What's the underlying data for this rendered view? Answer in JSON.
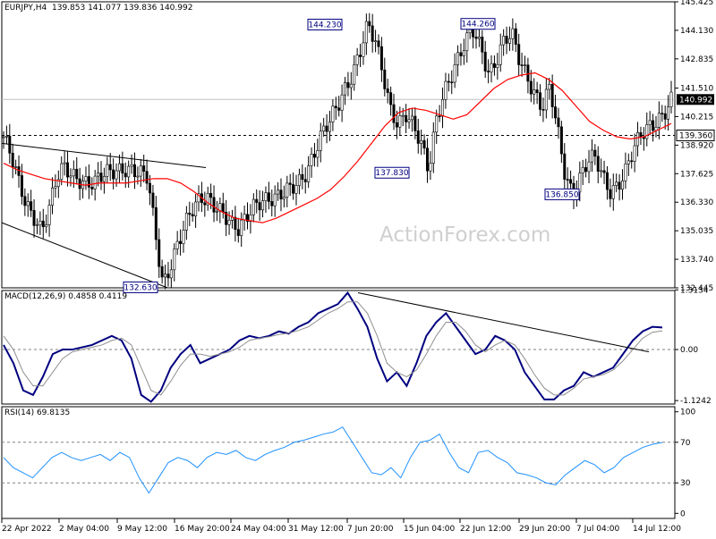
{
  "chart_data": [
    {
      "type": "candlestick",
      "title": "EURJPY,H4",
      "ohlc_text": "139.853 141.077 139.836 140.992",
      "last_price": 140.992,
      "last_price_label": "140.992",
      "ylim": [
        132.445,
        145.425
      ],
      "y_ticks": [
        "145.425",
        "144.130",
        "142.835",
        "141.510",
        "140.215",
        "138.920",
        "137.625",
        "136.330",
        "135.035",
        "133.740",
        "132.445"
      ],
      "x_labels": [
        "22 Apr 2022",
        "2 May 04:00",
        "9 May 12:00",
        "16 May 20:00",
        "24 May 04:00",
        "31 May 12:00",
        "7 Jun 20:00",
        "15 Jun 04:00",
        "22 Jun 12:00",
        "29 Jun 20:00",
        "7 Jul 04:00",
        "14 Jul 12:00"
      ],
      "level_line": 139.36,
      "level_label": "139.360",
      "annotations": [
        {
          "text": "144.230",
          "value": 144.23
        },
        {
          "text": "144.260",
          "value": 144.26
        },
        {
          "text": "137.830",
          "value": 137.83
        },
        {
          "text": "136.850",
          "value": 136.85
        },
        {
          "text": "132.630",
          "value": 132.63
        }
      ],
      "price_path": [
        139.3,
        138.3,
        137.1,
        136.2,
        135.8,
        135.2,
        136.0,
        137.3,
        137.8,
        137.6,
        137.5,
        137.3,
        137.2,
        137.4,
        137.6,
        137.8,
        138.0,
        137.9,
        137.6,
        137.3,
        134.8,
        132.63,
        133.6,
        134.6,
        135.3,
        135.9,
        136.4,
        136.6,
        136.3,
        135.9,
        135.2,
        134.9,
        135.6,
        136.3,
        136.6,
        136.5,
        136.4,
        136.6,
        137.0,
        137.4,
        137.9,
        138.6,
        139.3,
        139.9,
        140.7,
        141.6,
        142.3,
        143.2,
        144.23,
        143.5,
        142.2,
        140.7,
        140.0,
        140.3,
        139.6,
        138.9,
        137.83,
        140.2,
        141.4,
        142.0,
        142.7,
        143.6,
        144.26,
        143.4,
        142.2,
        142.7,
        143.5,
        143.9,
        142.9,
        142.2,
        141.3,
        140.5,
        141.4,
        139.6,
        137.7,
        136.85,
        137.5,
        138.1,
        138.2,
        137.4,
        136.9,
        137.3,
        137.8,
        138.6,
        139.2,
        139.7,
        140.1,
        140.5,
        140.992
      ],
      "moving_average": {
        "path": [
          138.1,
          137.8,
          137.6,
          137.4,
          137.3,
          137.2,
          137.1,
          137.2,
          137.2,
          137.2,
          137.3,
          137.4,
          137.4,
          137.2,
          136.8,
          136.3,
          135.9,
          135.6,
          135.5,
          135.4,
          135.6,
          135.9,
          136.2,
          136.5,
          136.9,
          137.5,
          138.2,
          139.0,
          139.8,
          140.4,
          140.6,
          140.5,
          140.3,
          140.1,
          140.3,
          140.9,
          141.5,
          141.9,
          142.1,
          142.2,
          141.9,
          141.4,
          140.7,
          140.0,
          139.6,
          139.3,
          139.2,
          139.3,
          139.6,
          139.9
        ],
        "color": "#ff0000"
      },
      "channel_lines": [
        {
          "start": 139.0,
          "end": 137.9
        },
        {
          "start": 135.4,
          "end": 132.45
        }
      ],
      "watermark": "ActionForex.com"
    },
    {
      "type": "line",
      "title": "MACD(12,26,9) 0.4858 0.4119",
      "ylim": [
        -1.2,
        1.3
      ],
      "y_ticks": [
        "1.3134",
        "0.00",
        "-1.1242"
      ],
      "series": [
        {
          "color": "#000080",
          "values": [
            0.1,
            -0.3,
            -0.9,
            -1.0,
            -0.6,
            -0.1,
            0.0,
            0.0,
            0.05,
            0.1,
            0.2,
            0.3,
            0.2,
            -0.2,
            -1.0,
            -1.15,
            -0.9,
            -0.4,
            -0.1,
            0.1,
            -0.3,
            -0.2,
            -0.1,
            0.0,
            0.2,
            0.3,
            0.25,
            0.3,
            0.4,
            0.35,
            0.5,
            0.6,
            0.8,
            0.9,
            1.0,
            1.25,
            0.9,
            0.5,
            -0.2,
            -0.7,
            -0.5,
            -0.8,
            -0.3,
            0.3,
            0.6,
            0.8,
            0.5,
            0.2,
            -0.1,
            0.0,
            0.3,
            0.2,
            0.0,
            -0.5,
            -0.8,
            -1.1,
            -1.1,
            -0.9,
            -0.8,
            -0.5,
            -0.6,
            -0.5,
            -0.4,
            -0.1,
            0.2,
            0.4,
            0.5,
            0.4858
          ]
        },
        {
          "color": "#909090",
          "values": [
            0.3,
            0.0,
            -0.5,
            -0.8,
            -0.8,
            -0.5,
            -0.2,
            -0.05,
            0.0,
            0.05,
            0.1,
            0.2,
            0.25,
            0.1,
            -0.4,
            -0.9,
            -1.0,
            -0.7,
            -0.35,
            -0.1,
            -0.1,
            -0.15,
            -0.1,
            -0.05,
            0.05,
            0.2,
            0.25,
            0.28,
            0.33,
            0.36,
            0.42,
            0.5,
            0.65,
            0.8,
            0.9,
            1.05,
            1.05,
            0.8,
            0.3,
            -0.3,
            -0.5,
            -0.6,
            -0.45,
            -0.1,
            0.3,
            0.6,
            0.6,
            0.4,
            0.1,
            -0.05,
            0.1,
            0.2,
            0.1,
            -0.2,
            -0.55,
            -0.85,
            -1.0,
            -1.0,
            -0.85,
            -0.65,
            -0.6,
            -0.55,
            -0.45,
            -0.25,
            0.0,
            0.25,
            0.38,
            0.4119
          ]
        }
      ],
      "trendline": {
        "start": 1.25,
        "end": -0.05
      }
    },
    {
      "type": "line",
      "title": "RSI(14) 69.8135",
      "ylim": [
        0,
        100
      ],
      "y_ticks": [
        "100",
        "70",
        "30",
        "0"
      ],
      "levels": [
        70,
        30
      ],
      "series": [
        {
          "color": "#1e90ff",
          "values": [
            55,
            45,
            40,
            35,
            45,
            55,
            60,
            55,
            52,
            55,
            58,
            52,
            60,
            55,
            35,
            20,
            35,
            50,
            55,
            52,
            45,
            55,
            60,
            58,
            62,
            55,
            52,
            58,
            62,
            65,
            70,
            72,
            75,
            78,
            80,
            85,
            70,
            55,
            40,
            38,
            45,
            35,
            55,
            70,
            72,
            78,
            60,
            45,
            40,
            60,
            62,
            55,
            50,
            40,
            38,
            35,
            30,
            28,
            38,
            45,
            52,
            48,
            40,
            45,
            55,
            60,
            65,
            68,
            69.8135
          ]
        }
      ]
    }
  ]
}
